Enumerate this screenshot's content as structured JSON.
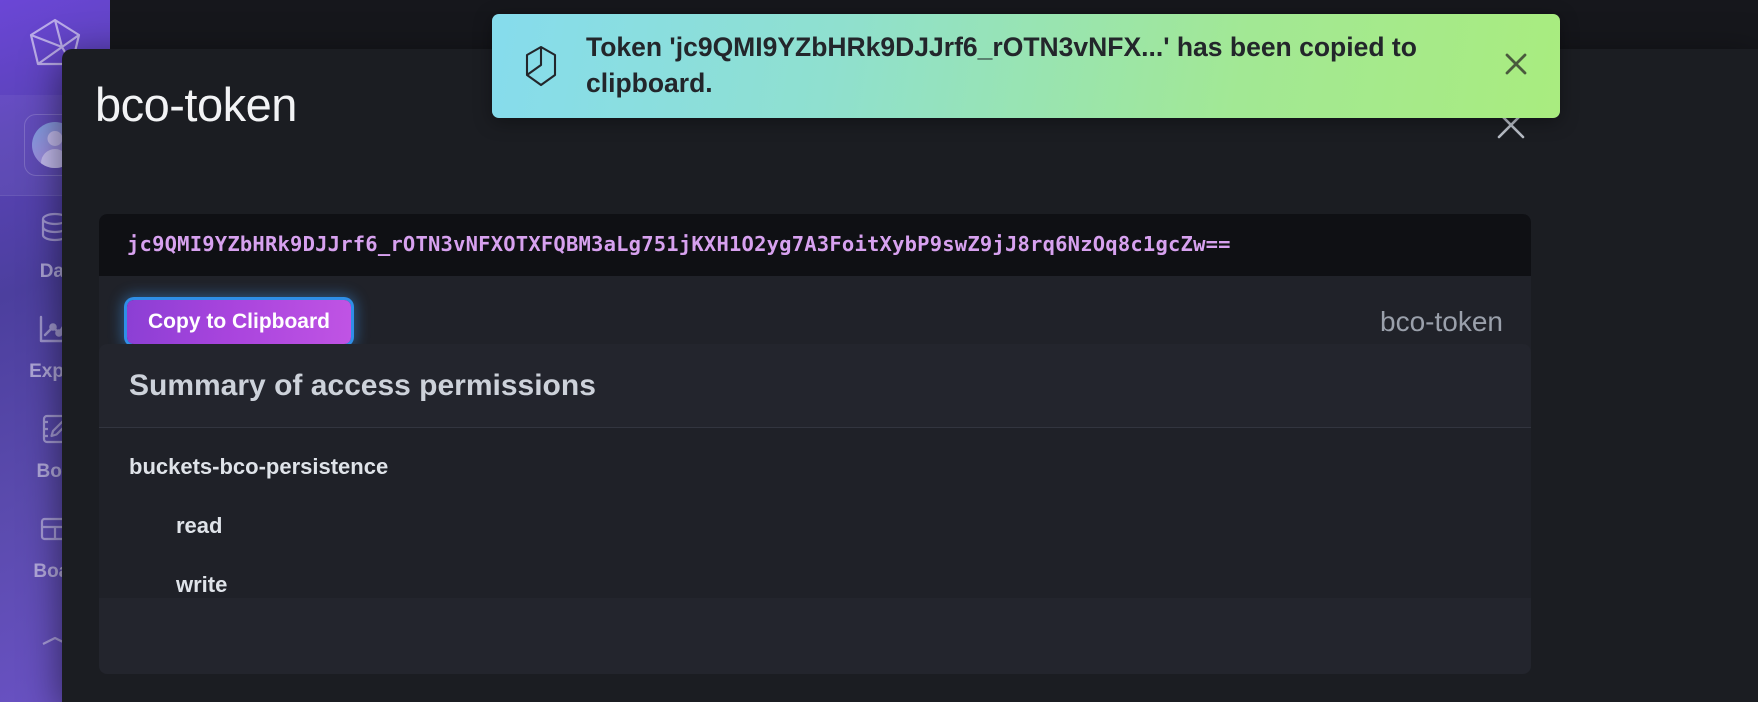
{
  "sidebar": {
    "logo_icon": "polyhedron-logo-icon",
    "avatar_label": "user-avatar",
    "items": [
      {
        "label": "Dat",
        "icon": "database-icon"
      },
      {
        "label": "Explo",
        "icon": "line-chart-icon"
      },
      {
        "label": "Boo",
        "icon": "notebook-pencil-icon"
      },
      {
        "label": "Boar",
        "icon": "dashboard-grid-icon"
      }
    ]
  },
  "modal": {
    "title": "bco-token",
    "close_icon": "close-icon",
    "token": {
      "value": "jc9QMI9YZbHRk9DJJrf6_rOTN3vNFXOTXFQBM3aLg751jKXH1O2yg7A3FoitXybP9swZ9jJ8rq6NzOq8c1gcZw==",
      "copy_button_label": "Copy to Clipboard",
      "token_name": "bco-token"
    },
    "permissions": {
      "header": "Summary of access permissions",
      "groups": [
        {
          "name": "buckets-bco-persistence",
          "scopes": [
            "read",
            "write"
          ]
        }
      ]
    }
  },
  "toast": {
    "icon": "package-cube-icon",
    "message": "Token 'jc9QMI9YZbHRk9DJJrf6_rOTN3vNFX...' has been copied to clipboard.",
    "close_icon": "close-icon"
  },
  "colors": {
    "accent_purple": "#a844dd",
    "focus_ring_blue": "#2f8fe8",
    "token_text": "#d7a1ef",
    "toast_from": "#86dced",
    "toast_to": "#a9ec7f",
    "modal_bg": "#1b1d22",
    "sidebar_from": "#6b46d6",
    "sidebar_to": "#4c3f9e"
  }
}
